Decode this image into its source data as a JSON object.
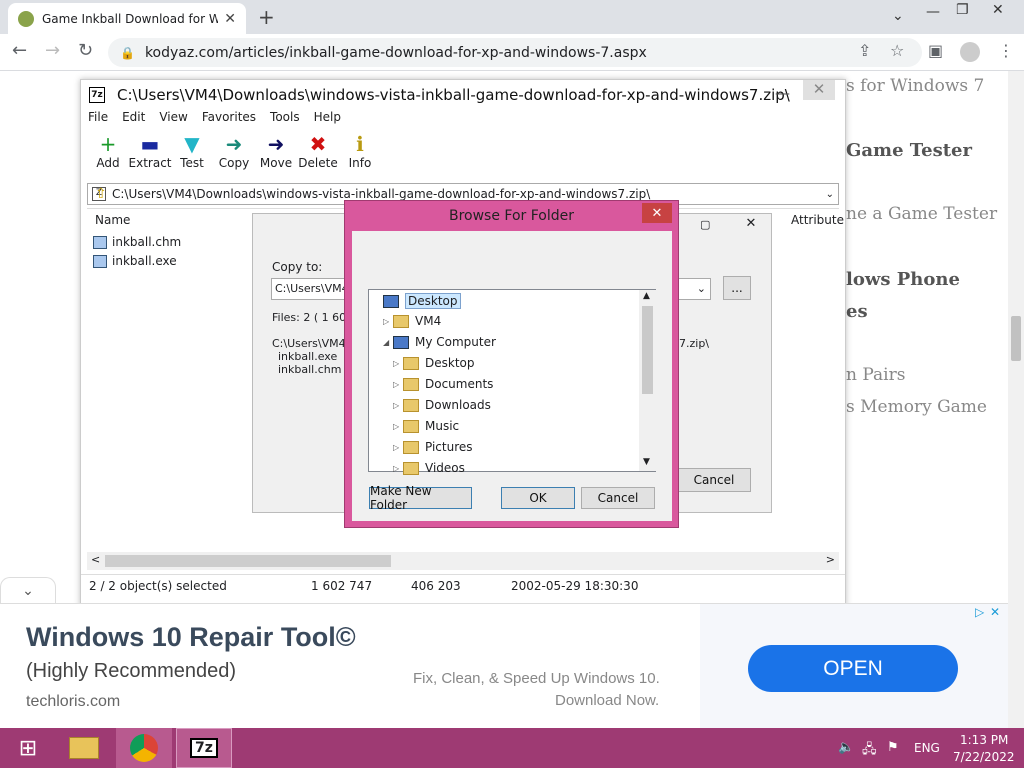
{
  "browser": {
    "tab_title": "Game Inkball Download for Wind",
    "url": "kodyaz.com/articles/inkball-game-download-for-xp-and-windows-7.aspx"
  },
  "page": {
    "lines": [
      "s for Windows 7",
      "Game Tester",
      "ne a Game Tester",
      "lows Phone",
      "es",
      "n Pairs",
      "s Memory Game"
    ]
  },
  "zip": {
    "title": "C:\\Users\\VM4\\Downloads\\windows-vista-inkball-game-download-for-xp-and-windows7.zip\\",
    "menu": [
      "File",
      "Edit",
      "View",
      "Favorites",
      "Tools",
      "Help"
    ],
    "tools": [
      {
        "label": "Add",
        "icon": "+",
        "color": "#1a9a2a"
      },
      {
        "label": "Extract",
        "icon": "▬",
        "color": "#1a2aa0"
      },
      {
        "label": "Test",
        "icon": "▼",
        "color": "#22b5c8"
      },
      {
        "label": "Copy",
        "icon": "➜",
        "color": "#1a8a7a"
      },
      {
        "label": "Move",
        "icon": "➜",
        "color": "#101060"
      },
      {
        "label": "Delete",
        "icon": "✖",
        "color": "#d01010"
      },
      {
        "label": "Info",
        "icon": "ℹ",
        "color": "#b89a10"
      }
    ],
    "path": "C:\\Users\\VM4\\Downloads\\windows-vista-inkball-game-download-for-xp-and-windows7.zip\\",
    "col_name": "Name",
    "col_attr": "Attribute",
    "files": [
      "inkball.chm",
      "inkball.exe"
    ],
    "status": {
      "selected": "2 / 2 object(s) selected",
      "size": "1 602 747",
      "packed": "406 203",
      "date": "2002-05-29 18:30:30"
    }
  },
  "copy": {
    "copy_to_label": "Copy to:",
    "copy_to_value": "C:\\Users\\VM4",
    "files_label": "Files: 2   ( 1 60",
    "src_path": "C:\\Users\\VM4\\",
    "src_suffix": "7.zip\\",
    "items": [
      "inkball.exe",
      "inkball.chm"
    ],
    "browse_btn": "...",
    "cancel": "Cancel"
  },
  "browse": {
    "title": "Browse For Folder",
    "tree": [
      {
        "label": "Desktop",
        "level": 0,
        "arrow": "",
        "selected": true,
        "icon": "pc"
      },
      {
        "label": "VM4",
        "level": 1,
        "arrow": "▷",
        "icon": "folder"
      },
      {
        "label": "My Computer",
        "level": 1,
        "arrow": "◢",
        "icon": "pc"
      },
      {
        "label": "Desktop",
        "level": 2,
        "arrow": "▷",
        "icon": "folder"
      },
      {
        "label": "Documents",
        "level": 2,
        "arrow": "▷",
        "icon": "folder"
      },
      {
        "label": "Downloads",
        "level": 2,
        "arrow": "▷",
        "icon": "folder"
      },
      {
        "label": "Music",
        "level": 2,
        "arrow": "▷",
        "icon": "folder"
      },
      {
        "label": "Pictures",
        "level": 2,
        "arrow": "▷",
        "icon": "folder"
      },
      {
        "label": "Videos",
        "level": 2,
        "arrow": "▷",
        "icon": "folder"
      }
    ],
    "make_folder": "Make New Folder",
    "ok": "OK",
    "cancel": "Cancel"
  },
  "ad": {
    "headline": "Windows 10 Repair Tool©",
    "sub": "(Highly Recommended)",
    "domain": "techloris.com",
    "desc1": "Fix, Clean, & Speed Up Windows 10.",
    "desc2": "Download Now.",
    "cta": "OPEN"
  },
  "taskbar": {
    "lang": "ENG",
    "time": "1:13 PM",
    "date": "7/22/2022"
  }
}
